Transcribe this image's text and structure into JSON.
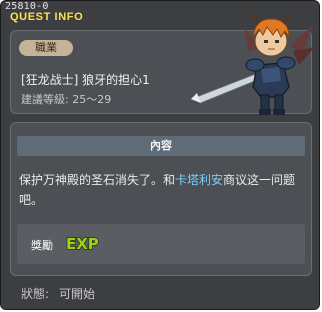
{
  "window": {
    "id": "25810-0",
    "title": "QUEST INFO"
  },
  "quest": {
    "job_tag": "職業",
    "name": "[狂龙战士] 狼牙的担心1",
    "level_label": "建議等級:",
    "level_range": "25～29"
  },
  "content": {
    "header": "內容",
    "description_parts": {
      "before": "保护万神殿的圣石消失了。和",
      "npc": "卡塔利安",
      "after": "商议这一问题吧。"
    }
  },
  "reward": {
    "label": "獎勵",
    "exp_text": "EXP"
  },
  "status": {
    "label": "狀態:",
    "value": "可開始"
  },
  "colors": {
    "title": "#ffe14a",
    "npc_highlight": "#7ad0ff",
    "exp_fill": "#9bd21d"
  },
  "icons": {
    "character": "kaiser-character-icon",
    "exp": "exp-icon"
  }
}
